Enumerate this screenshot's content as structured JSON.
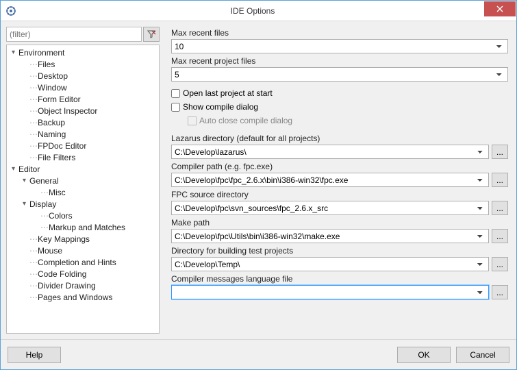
{
  "window": {
    "title": "IDE Options"
  },
  "filter": {
    "placeholder": "(filter)"
  },
  "tree": [
    {
      "d": 0,
      "tw": "▾",
      "label": "Environment"
    },
    {
      "d": 1,
      "tw": "",
      "label": "Files"
    },
    {
      "d": 1,
      "tw": "",
      "label": "Desktop"
    },
    {
      "d": 1,
      "tw": "",
      "label": "Window"
    },
    {
      "d": 1,
      "tw": "",
      "label": "Form Editor"
    },
    {
      "d": 1,
      "tw": "",
      "label": "Object Inspector"
    },
    {
      "d": 1,
      "tw": "",
      "label": "Backup"
    },
    {
      "d": 1,
      "tw": "",
      "label": "Naming"
    },
    {
      "d": 1,
      "tw": "",
      "label": "FPDoc Editor"
    },
    {
      "d": 1,
      "tw": "",
      "label": "File Filters"
    },
    {
      "d": 0,
      "tw": "▾",
      "label": "Editor"
    },
    {
      "d": 1,
      "tw": "▾",
      "label": "General"
    },
    {
      "d": 2,
      "tw": "",
      "label": "Misc"
    },
    {
      "d": 1,
      "tw": "▾",
      "label": "Display"
    },
    {
      "d": 2,
      "tw": "",
      "label": "Colors"
    },
    {
      "d": 2,
      "tw": "",
      "label": "Markup and Matches"
    },
    {
      "d": 1,
      "tw": "",
      "label": "Key Mappings"
    },
    {
      "d": 1,
      "tw": "",
      "label": "Mouse"
    },
    {
      "d": 1,
      "tw": "",
      "label": "Completion and Hints"
    },
    {
      "d": 1,
      "tw": "",
      "label": "Code Folding"
    },
    {
      "d": 1,
      "tw": "",
      "label": "Divider Drawing"
    },
    {
      "d": 1,
      "tw": "",
      "label": "Pages and Windows"
    }
  ],
  "fields": {
    "maxRecent": {
      "label": "Max recent files",
      "value": "10"
    },
    "maxRecentProj": {
      "label": "Max recent project files",
      "value": "5"
    },
    "openLast": {
      "label": "Open last project at start"
    },
    "showCompile": {
      "label": "Show compile dialog"
    },
    "autoClose": {
      "label": "Auto close compile dialog"
    },
    "lazDir": {
      "label": "Lazarus directory (default for all projects)",
      "value": "C:\\Develop\\lazarus\\"
    },
    "compPath": {
      "label": "Compiler path (e.g. fpc.exe)",
      "value": "C:\\Develop\\fpc\\fpc_2.6.x\\bin\\i386-win32\\fpc.exe"
    },
    "fpcSrc": {
      "label": "FPC source directory",
      "value": "C:\\Develop\\fpc\\svn_sources\\fpc_2.6.x_src"
    },
    "makePath": {
      "label": "Make path",
      "value": "C:\\Develop\\fpc\\Utils\\bin\\i386-win32\\make.exe"
    },
    "testDir": {
      "label": "Directory for building test projects",
      "value": "C:\\Develop\\Temp\\"
    },
    "msgFile": {
      "label": "Compiler messages language file",
      "value": ""
    }
  },
  "buttons": {
    "help": "Help",
    "ok": "OK",
    "cancel": "Cancel",
    "browse": "..."
  }
}
